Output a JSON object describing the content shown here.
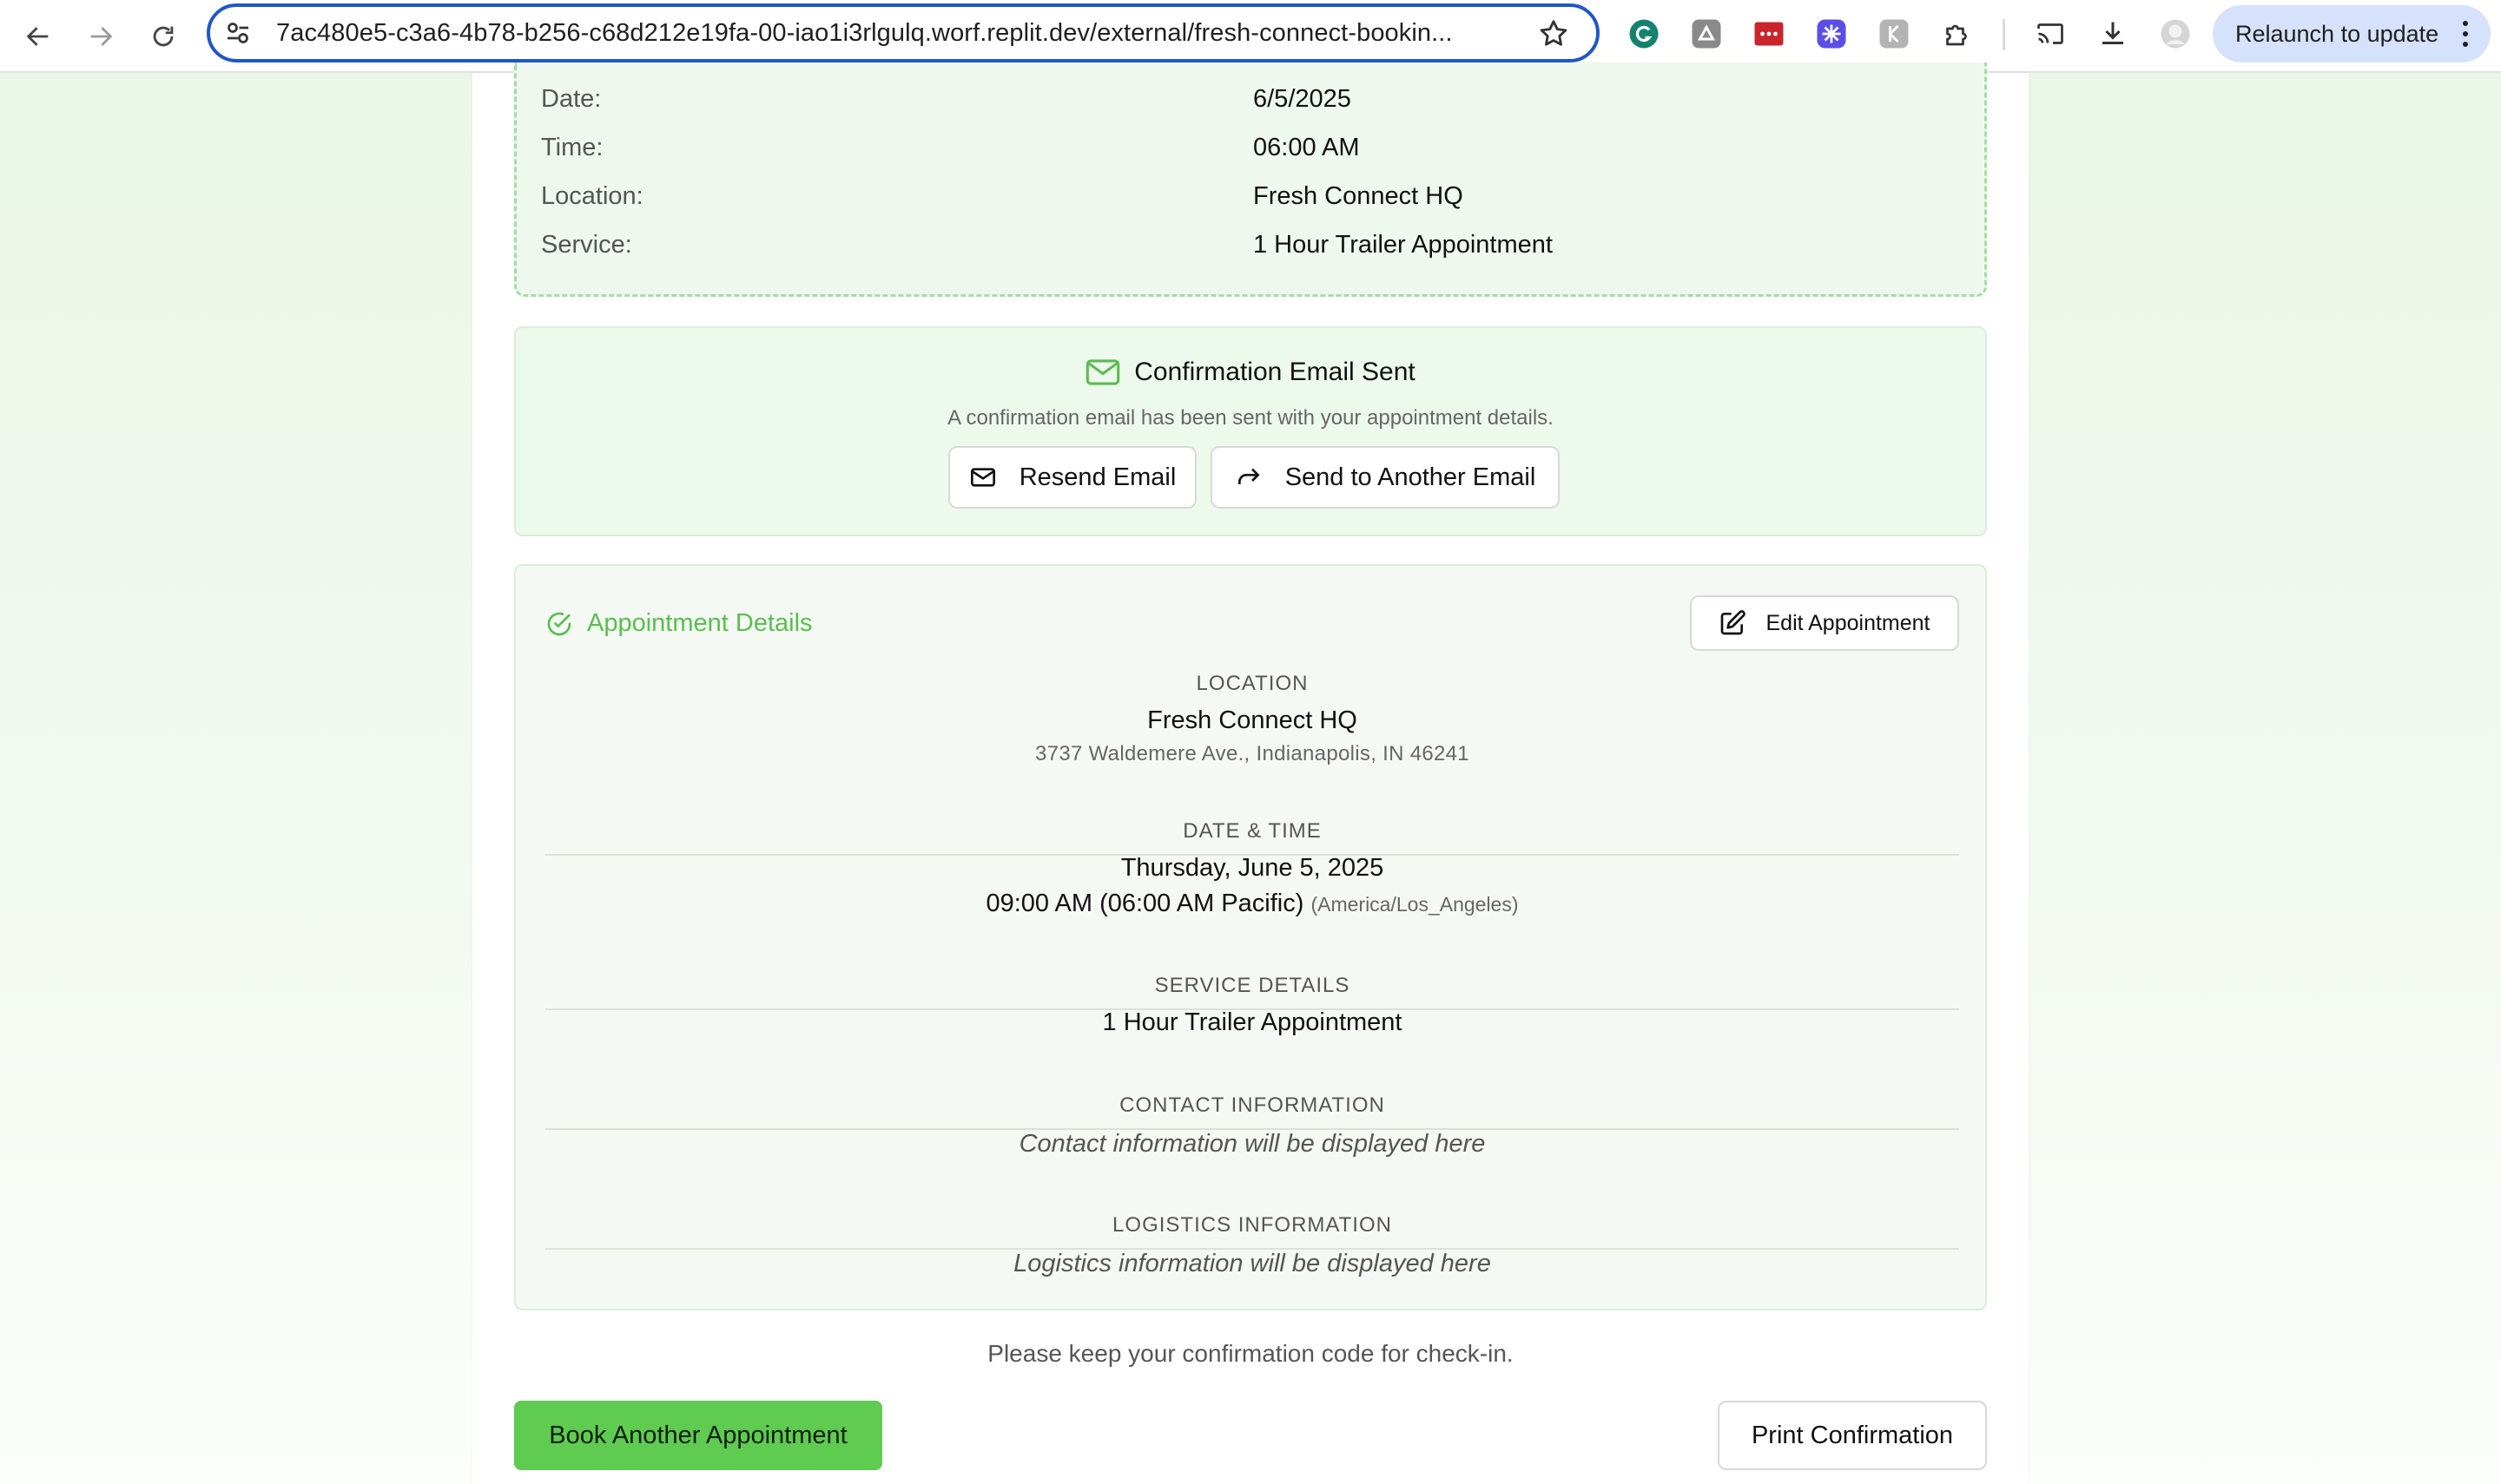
{
  "browser": {
    "url": "7ac480e5-c3a6-4b78-b256-c68d212e19fa-00-iao1i3rlgulq.worf.replit.dev/external/fresh-connect-bookin...",
    "relaunch_label": "Relaunch to update",
    "icons": [
      "back-icon",
      "forward-icon",
      "reload-icon",
      "site-settings-icon",
      "bookmark-star-icon",
      "grammarly-extension-icon",
      "extension-icon",
      "extension-icon",
      "extension-icon",
      "extension-icon",
      "extensions-puzzle-icon",
      "cast-icon",
      "download-icon",
      "profile-avatar-icon",
      "more-menu-icon"
    ]
  },
  "summary": {
    "rows": [
      {
        "label": "Date:",
        "value": "6/5/2025"
      },
      {
        "label": "Time:",
        "value": "06:00 AM"
      },
      {
        "label": "Location:",
        "value": "Fresh Connect HQ"
      },
      {
        "label": "Service:",
        "value": "1 Hour Trailer Appointment"
      }
    ]
  },
  "email": {
    "title": "Confirmation Email Sent",
    "subtitle": "A confirmation email has been sent with your appointment details.",
    "resend_label": "Resend Email",
    "send_another_label": "Send to Another Email"
  },
  "details": {
    "heading": "Appointment Details",
    "edit_label": "Edit Appointment",
    "location": {
      "caption": "LOCATION",
      "name": "Fresh Connect HQ",
      "address": "3737 Waldemere Ave., Indianapolis, IN 46241"
    },
    "datetime": {
      "caption": "DATE & TIME",
      "date": "Thursday, June 5, 2025",
      "time": "09:00 AM (06:00 AM Pacific)",
      "timezone": "(America/Los_Angeles)"
    },
    "service": {
      "caption": "SERVICE DETAILS",
      "name": "1 Hour Trailer Appointment"
    },
    "contact": {
      "caption": "CONTACT INFORMATION",
      "placeholder": "Contact information will be displayed here"
    },
    "logistics": {
      "caption": "LOGISTICS INFORMATION",
      "placeholder": "Logistics information will be displayed here"
    }
  },
  "footer": {
    "note": "Please keep your confirmation code for check-in.",
    "book_another_label": "Book Another Appointment",
    "print_label": "Print Confirmation"
  },
  "colors": {
    "accent_green": "#5fcb51",
    "heading_green": "#5bbd50",
    "omnibox_border": "#1f56c9",
    "relaunch_bg": "#d6e2fb"
  }
}
